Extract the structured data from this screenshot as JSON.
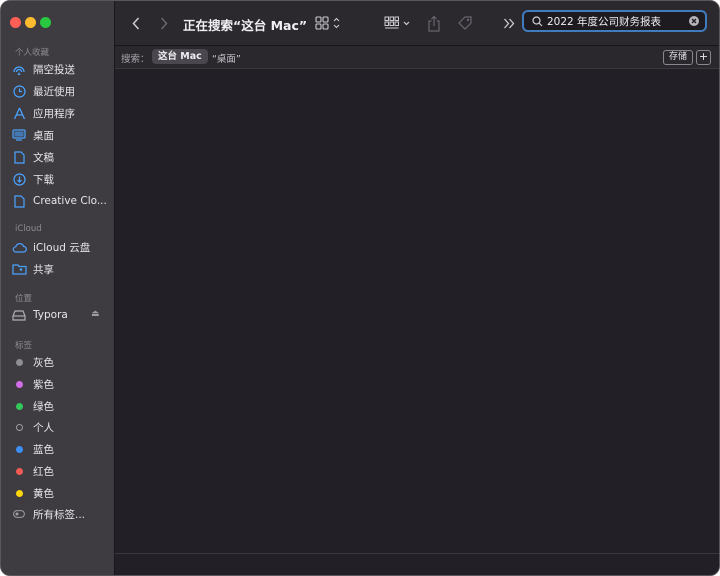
{
  "window": {
    "title": "正在搜索“这台 Mac”",
    "search_query": "2022 年度公司财务报表"
  },
  "sidebar": {
    "sections": [
      {
        "title": "个人收藏",
        "items": [
          {
            "label": "隔空投送",
            "icon": "airdrop-icon"
          },
          {
            "label": "最近使用",
            "icon": "clock-icon"
          },
          {
            "label": "应用程序",
            "icon": "applications-icon"
          },
          {
            "label": "桌面",
            "icon": "desktop-icon"
          },
          {
            "label": "文稿",
            "icon": "document-icon"
          },
          {
            "label": "下载",
            "icon": "download-icon"
          },
          {
            "label": "Creative Clo...",
            "icon": "file-icon"
          }
        ]
      },
      {
        "title": "iCloud",
        "items": [
          {
            "label": "iCloud 云盘",
            "icon": "cloud-icon"
          },
          {
            "label": "共享",
            "icon": "shared-folder-icon"
          }
        ]
      },
      {
        "title": "位置",
        "items": [
          {
            "label": "Typora",
            "icon": "drive-icon"
          }
        ]
      },
      {
        "title": "标签",
        "items": [
          {
            "label": "灰色",
            "color": "#8e8e93"
          },
          {
            "label": "紫色",
            "color": "#d36ce8"
          },
          {
            "label": "绿色",
            "color": "#34c759"
          },
          {
            "label": "个人",
            "color": "hollow"
          },
          {
            "label": "蓝色",
            "color": "#3d8ff5"
          },
          {
            "label": "红色",
            "color": "#f25b55"
          },
          {
            "label": "黄色",
            "color": "#ffd60a"
          },
          {
            "label": "所有标签...",
            "icon": "all-tags-icon"
          }
        ]
      }
    ]
  },
  "scope": {
    "label": "搜索：",
    "selected": "这台 Mac",
    "option": "“桌面”",
    "save_label": "存储",
    "add_label": "+"
  }
}
